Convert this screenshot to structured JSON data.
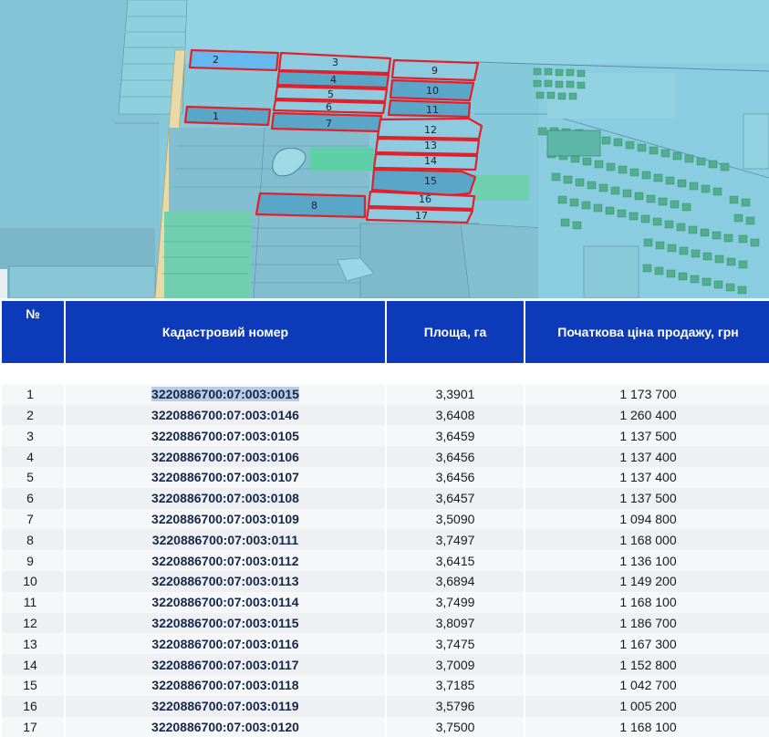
{
  "map": {
    "plot_labels": [
      "1",
      "2",
      "3",
      "4",
      "5",
      "6",
      "7",
      "8",
      "9",
      "10",
      "11",
      "12",
      "13",
      "14",
      "15",
      "16",
      "17"
    ]
  },
  "table": {
    "headers": {
      "no": "№",
      "cadastral": "Кадастровий номер",
      "area": "Площа, га",
      "price": "Початкова ціна продажу, грн"
    },
    "rows": [
      {
        "no": "1",
        "cadastral": "3220886700:07:003:0015",
        "area": "3,3901",
        "price": "1 173 700"
      },
      {
        "no": "2",
        "cadastral": "3220886700:07:003:0146",
        "area": "3,6408",
        "price": "1 260 400"
      },
      {
        "no": "3",
        "cadastral": "3220886700:07:003:0105",
        "area": "3,6459",
        "price": "1 137 500"
      },
      {
        "no": "4",
        "cadastral": "3220886700:07:003:0106",
        "area": "3,6456",
        "price": "1 137 400"
      },
      {
        "no": "5",
        "cadastral": "3220886700:07:003:0107",
        "area": "3,6456",
        "price": "1 137 400"
      },
      {
        "no": "6",
        "cadastral": "3220886700:07:003:0108",
        "area": "3,6457",
        "price": "1 137 500"
      },
      {
        "no": "7",
        "cadastral": "3220886700:07:003:0109",
        "area": "3,5090",
        "price": "1 094 800"
      },
      {
        "no": "8",
        "cadastral": "3220886700:07:003:0111",
        "area": "3,7497",
        "price": "1 168 000"
      },
      {
        "no": "9",
        "cadastral": "3220886700:07:003:0112",
        "area": "3,6415",
        "price": "1 136 100"
      },
      {
        "no": "10",
        "cadastral": "3220886700:07:003:0113",
        "area": "3,6894",
        "price": "1 149 200"
      },
      {
        "no": "11",
        "cadastral": "3220886700:07:003:0114",
        "area": "3,7499",
        "price": "1 168 100"
      },
      {
        "no": "12",
        "cadastral": "3220886700:07:003:0115",
        "area": "3,8097",
        "price": "1 186 700"
      },
      {
        "no": "13",
        "cadastral": "3220886700:07:003:0116",
        "area": "3,7475",
        "price": "1 167 300"
      },
      {
        "no": "14",
        "cadastral": "3220886700:07:003:0117",
        "area": "3,7009",
        "price": "1 152 800"
      },
      {
        "no": "15",
        "cadastral": "3220886700:07:003:0118",
        "area": "3,7185",
        "price": "1 042 700"
      },
      {
        "no": "16",
        "cadastral": "3220886700:07:003:0119",
        "area": "3,5796",
        "price": "1 005 200"
      },
      {
        "no": "17",
        "cadastral": "3220886700:07:003:0120",
        "area": "3,7500",
        "price": "1 168 100"
      }
    ]
  },
  "colors": {
    "header_bg": "#0d3ab8",
    "plot_outline": "#e0202a",
    "map_water": "#8ecfe0",
    "map_field": "#7fb7c9",
    "map_green": "#5fcfa8"
  }
}
